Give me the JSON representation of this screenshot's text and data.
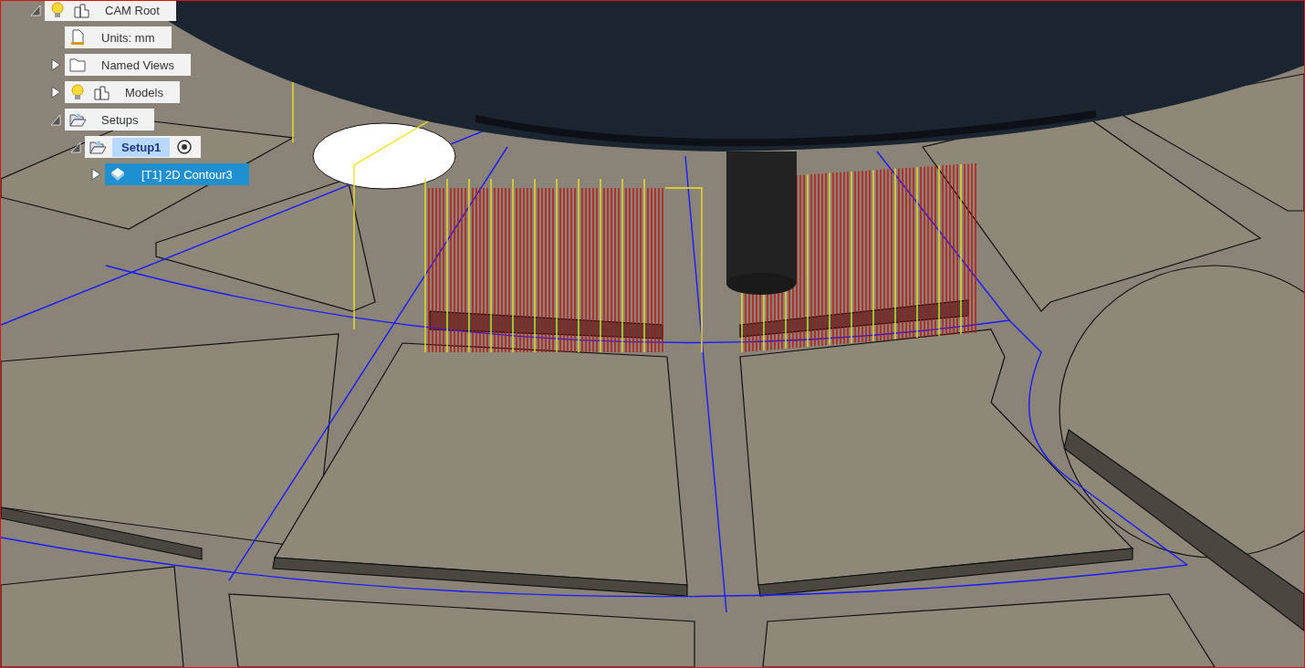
{
  "browser": {
    "root": {
      "label": "CAM Root",
      "kind": "root",
      "expanded": true,
      "children": [
        {
          "label": "Units: mm",
          "kind": "units"
        },
        {
          "label": "Named Views",
          "kind": "folder",
          "expanded": false
        },
        {
          "label": "Models",
          "kind": "models",
          "expanded": false
        },
        {
          "label": "Setups",
          "kind": "setups",
          "expanded": true,
          "children": [
            {
              "label": "Setup1",
              "kind": "setup",
              "expanded": true,
              "active": true,
              "children": [
                {
                  "label": "[T1] 2D Contour3",
                  "kind": "operation",
                  "expanded": false,
                  "selected": true
                }
              ]
            }
          ]
        }
      ]
    }
  }
}
